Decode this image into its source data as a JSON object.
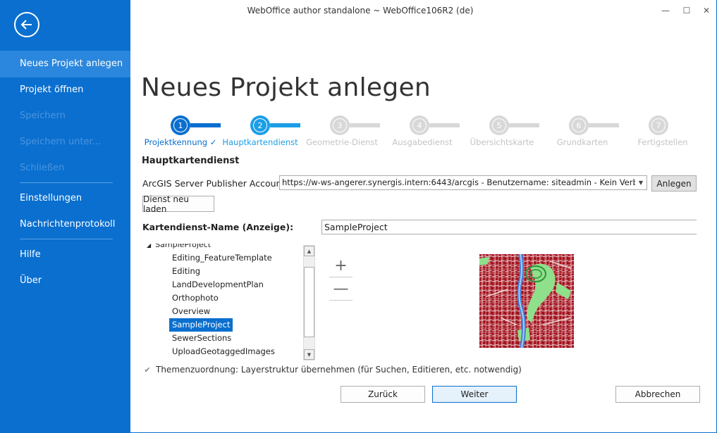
{
  "window": {
    "title": "WebOffice author standalone ~ WebOffice106R2 (de)",
    "minimize": "—",
    "maximize": "☐",
    "close": "✕"
  },
  "sidebar": {
    "items": [
      {
        "label": "Neues Projekt anlegen",
        "state": "active"
      },
      {
        "label": "Projekt öffnen",
        "state": "normal"
      },
      {
        "label": "Speichern",
        "state": "disabled"
      },
      {
        "label": "Speichern unter...",
        "state": "disabled"
      },
      {
        "label": "Schließen",
        "state": "disabled"
      },
      {
        "label": "Einstellungen",
        "state": "normal"
      },
      {
        "label": "Nachrichtenprotokoll",
        "state": "normal"
      },
      {
        "label": "Hilfe",
        "state": "normal"
      },
      {
        "label": "Über",
        "state": "normal"
      }
    ]
  },
  "page": {
    "title": "Neues Projekt anlegen",
    "section_title": "Hauptkartendienst"
  },
  "steps": [
    {
      "num": "1",
      "label": "Projektkennung ✓",
      "state": "done"
    },
    {
      "num": "2",
      "label": "Hauptkartendienst",
      "state": "current"
    },
    {
      "num": "3",
      "label": "Geometrie-Dienst",
      "state": "pending"
    },
    {
      "num": "4",
      "label": "Ausgabedienst",
      "state": "pending"
    },
    {
      "num": "5",
      "label": "Übersichtskarte",
      "state": "pending"
    },
    {
      "num": "6",
      "label": "Grundkarten",
      "state": "pending"
    },
    {
      "num": "7",
      "label": "Fertigstellen",
      "state": "pending"
    }
  ],
  "account": {
    "label": "ArcGIS Server Publisher Account:",
    "value": "https://w-ws-angerer.synergis.intern:6443/arcgis  -  Benutzername: siteadmin - Kein Verbundserver",
    "create_button": "Anlegen"
  },
  "reload_button": "Dienst neu laden",
  "service_name": {
    "label": "Kartendienst-Name (Anzeige):",
    "value": "SampleProject"
  },
  "tree": {
    "root": "SampleProject",
    "items": [
      "Editing_FeatureTemplate",
      "Editing",
      "LandDevelopmentPlan",
      "Orthophoto",
      "Overview",
      "SampleProject",
      "SewerSections",
      "UploadGeotaggedImages"
    ],
    "selected_index": 5
  },
  "map": {
    "zoom_in": "+",
    "zoom_out": "—"
  },
  "theme_checkbox": {
    "label": "Themenzuordnung: Layerstruktur übernehmen (für Suchen, Editieren, etc. notwendig)",
    "checked": true
  },
  "footer": {
    "back": "Zurück",
    "next": "Weiter",
    "cancel": "Abbrechen"
  },
  "colors": {
    "sidebar": "#0a6fcf",
    "step_done": "#0a6fcf",
    "step_current": "#1c9ee6",
    "step_pending": "#d8d8d8"
  }
}
